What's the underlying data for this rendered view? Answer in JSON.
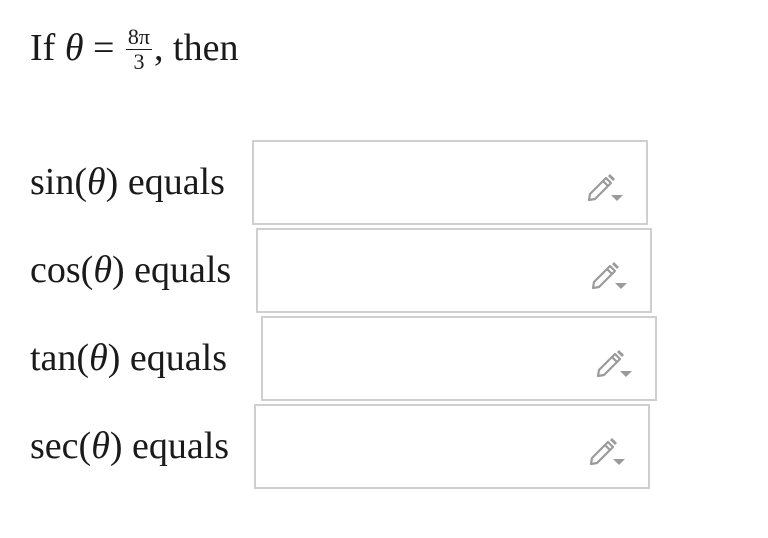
{
  "prompt": {
    "prefix": "If ",
    "variable": "θ",
    "equals": " = ",
    "numerator": "8π",
    "denominator": "3",
    "suffix": ", then"
  },
  "rows": [
    {
      "func": "sin(",
      "var": "θ",
      "close": ") equals",
      "value": ""
    },
    {
      "func": "cos(",
      "var": "θ",
      "close": ") equals",
      "value": ""
    },
    {
      "func": "tan(",
      "var": "θ",
      "close": ") equals",
      "value": ""
    },
    {
      "func": "sec(",
      "var": "θ",
      "close": ") equals",
      "value": ""
    }
  ],
  "icon": {
    "name": "pencil-dropdown-icon",
    "color": "#9a9a9a"
  },
  "colors": {
    "border": "#cfcfcf",
    "text": "#1a1a1a"
  }
}
